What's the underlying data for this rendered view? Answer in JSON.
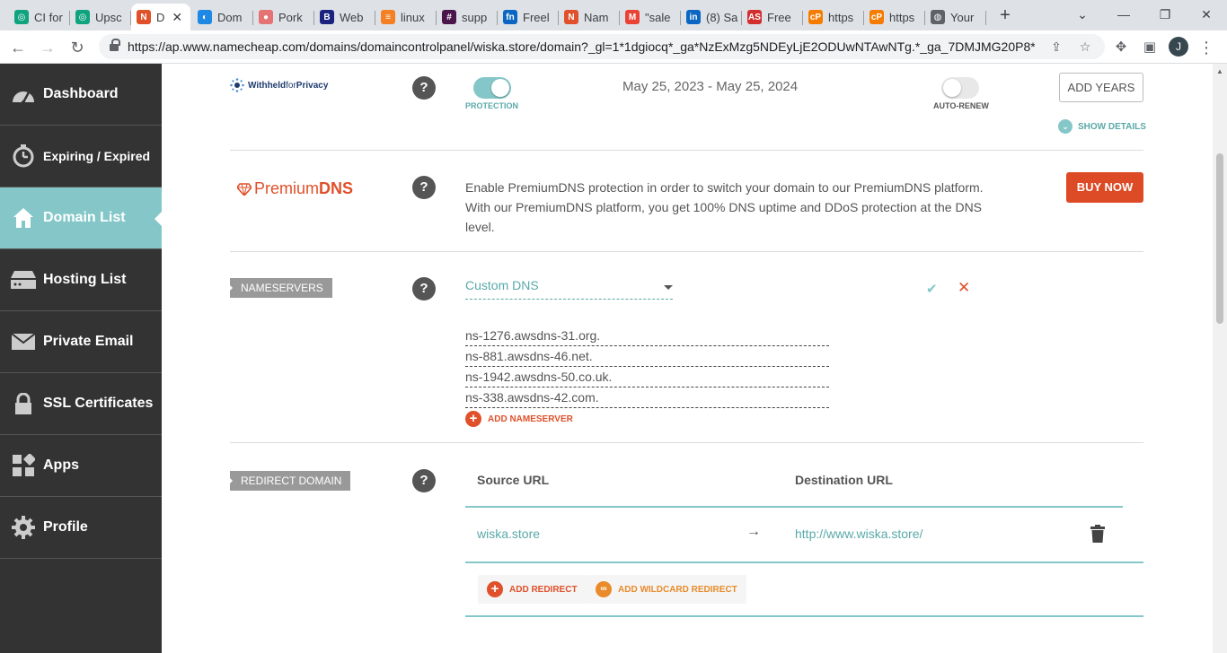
{
  "browser": {
    "tabs": [
      {
        "label": "CI for",
        "color": "#10a37f",
        "glyph": "◎"
      },
      {
        "label": "Upsc",
        "color": "#10a37f",
        "glyph": "◎"
      },
      {
        "label": "D",
        "color": "#e0502a",
        "glyph": "N",
        "active": true
      },
      {
        "label": "Dom",
        "color": "#1e88e5",
        "glyph": "◐"
      },
      {
        "label": "Pork",
        "color": "#e57373",
        "glyph": "●"
      },
      {
        "label": "Web",
        "color": "#1a237e",
        "glyph": "B"
      },
      {
        "label": "linux",
        "color": "#f48024",
        "glyph": "≡"
      },
      {
        "label": "supp",
        "color": "#4a154b",
        "glyph": "#"
      },
      {
        "label": "Freel",
        "color": "#0a66c2",
        "glyph": "fn"
      },
      {
        "label": "Nam",
        "color": "#e0502a",
        "glyph": "N"
      },
      {
        "label": "\"sale",
        "color": "#ea4335",
        "glyph": "M"
      },
      {
        "label": "(8) Sa",
        "color": "#0a66c2",
        "glyph": "in"
      },
      {
        "label": "Free",
        "color": "#d32f2f",
        "glyph": "AS"
      },
      {
        "label": "https",
        "color": "#f57c00",
        "glyph": "cP"
      },
      {
        "label": "https",
        "color": "#f57c00",
        "glyph": "cP"
      },
      {
        "label": "Your",
        "color": "#5f6368",
        "glyph": "◍"
      }
    ],
    "url": "https://ap.www.namecheap.com/domains/domaincontrolpanel/wiska.store/domain?_gl=1*1dgiocq*_ga*NzExMzg5NDEyLjE2ODUwNTAwNTg.*_ga_7DMJMG20P8*...",
    "profile_initial": "J"
  },
  "sidebar": {
    "items": [
      {
        "label": "Dashboard",
        "icon": "gauge-icon"
      },
      {
        "label": "Expiring / Expired",
        "icon": "stopwatch-icon"
      },
      {
        "label": "Domain List",
        "icon": "home-icon",
        "active": true
      },
      {
        "label": "Hosting List",
        "icon": "server-icon"
      },
      {
        "label": "Private Email",
        "icon": "envelope-icon"
      },
      {
        "label": "SSL Certificates",
        "icon": "lock-icon"
      },
      {
        "label": "Apps",
        "icon": "apps-icon"
      },
      {
        "label": "Profile",
        "icon": "gear-icon"
      }
    ]
  },
  "privacy": {
    "brand_a": "Withheld",
    "brand_b": "for",
    "brand_c": "Privacy",
    "protection_label": "PROTECTION",
    "protection_on": true,
    "dates": "May 25, 2023 - May 25, 2024",
    "autorenew_label": "AUTO-RENEW",
    "autorenew_on": false,
    "add_years_label": "ADD YEARS",
    "show_details_label": "SHOW DETAILS"
  },
  "premiumdns": {
    "brand_a": "Premium",
    "brand_b": "DNS",
    "description": "Enable PremiumDNS protection in order to switch your domain to our PremiumDNS platform. With our PremiumDNS platform, you get 100% DNS uptime and DDoS protection at the DNS level.",
    "buy_label": "BUY NOW"
  },
  "nameservers": {
    "tag": "NAMESERVERS",
    "selected": "Custom DNS",
    "list": [
      "ns-1276.awsdns-31.org.",
      "ns-881.awsdns-46.net.",
      "ns-1942.awsdns-50.co.uk.",
      "ns-338.awsdns-42.com."
    ],
    "add_label": "ADD NAMESERVER"
  },
  "redirect": {
    "tag": "REDIRECT DOMAIN",
    "source_header": "Source URL",
    "dest_header": "Destination URL",
    "source": "wiska.store",
    "arrow": "→",
    "destination": "http://www.wiska.store/",
    "add_redirect_label": "ADD REDIRECT",
    "add_wildcard_label": "ADD WILDCARD REDIRECT"
  },
  "colors": {
    "accent": "#85c7c9",
    "brand": "#e0502a",
    "sidebar": "#333333"
  }
}
